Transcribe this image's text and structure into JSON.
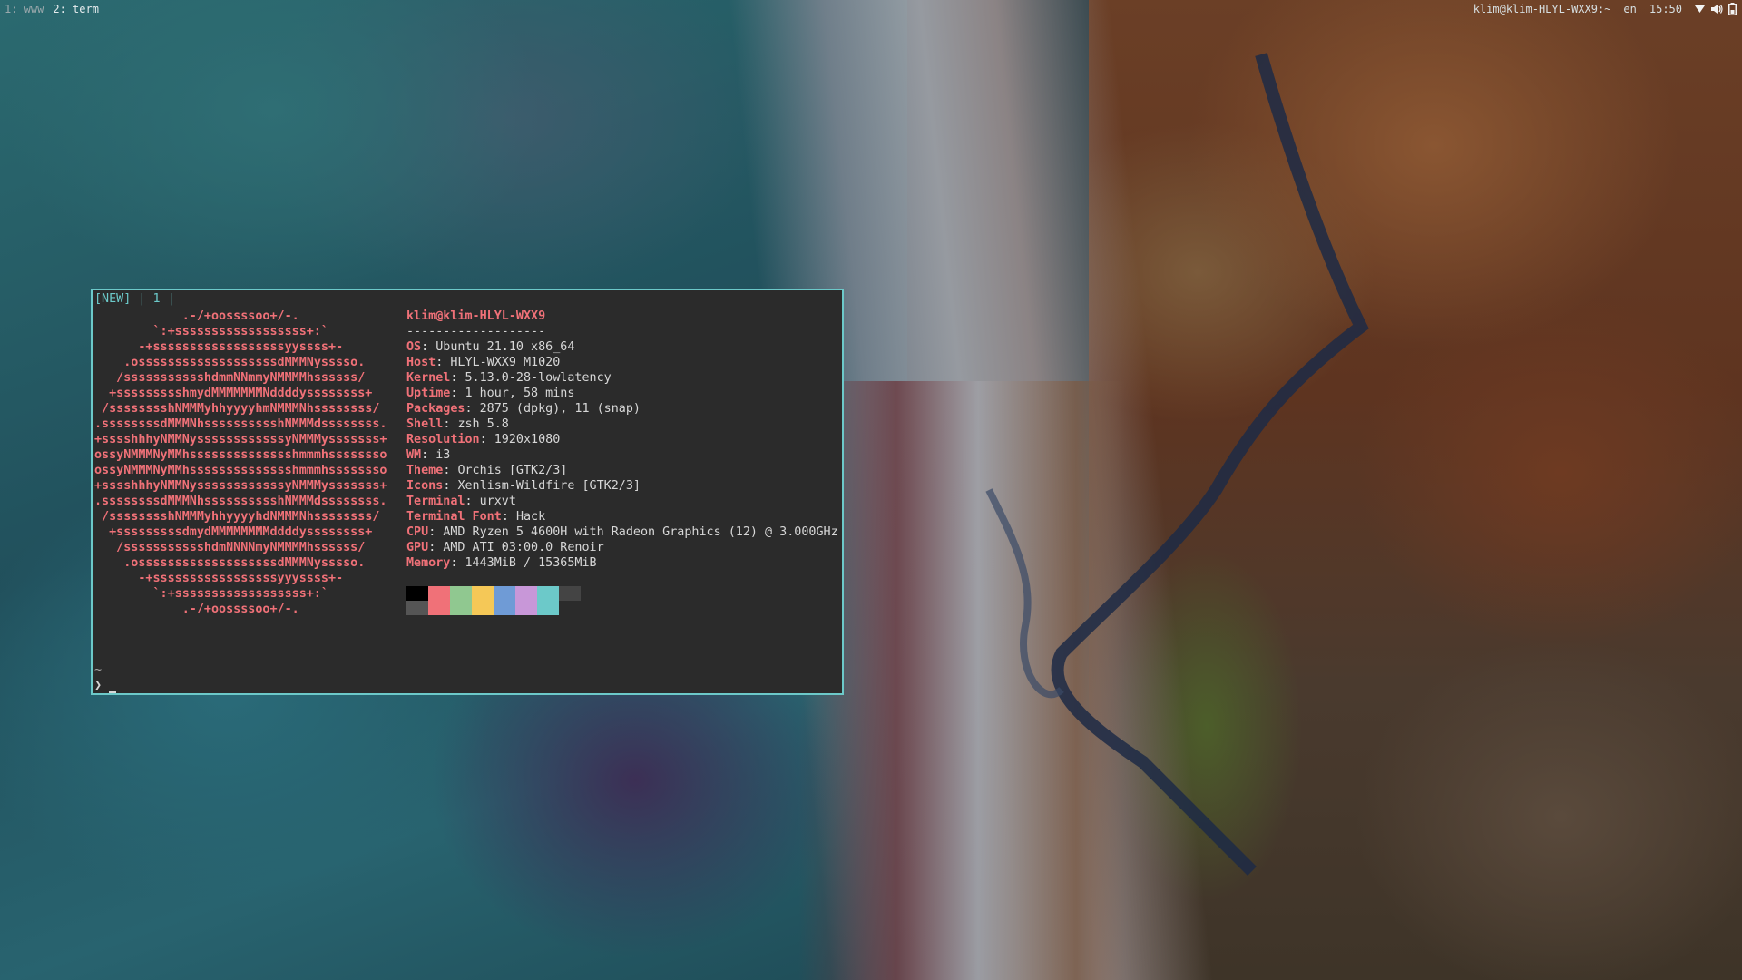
{
  "topbar": {
    "workspaces": [
      "1: www",
      "2: term"
    ],
    "active_workspace": "2: term",
    "window_title": "klim@klim-HLYL-WXX9:~",
    "keyboard_layout": "en",
    "clock": "15:50",
    "icons": [
      "wifi-icon",
      "volume-icon",
      "battery-icon"
    ]
  },
  "terminal": {
    "tabbar": "[NEW] | 1 |",
    "ascii_art": [
      "            .-/+oossssoo+/-.",
      "        `:+ssssssssssssssssss+:`",
      "      -+ssssssssssssssssssyyssss+-",
      "    .osssssssssssssssssssdMMMNysssso.",
      "   /ssssssssssshdmmNNmmyNMMMMhssssss/",
      "  +ssssssssshmydMMMMMMMNddddyssssssss+",
      " /sssssssshNMMMyhhyyyyhmNMMMNhssssssss/",
      ".ssssssssdMMMNhsssssssssshNMMMdssssssss.",
      "+sssshhhyNMMNyssssssssssssyNMMMysssssss+",
      "ossyNMMMNyMMhsssssssssssssshmmmhssssssso",
      "ossyNMMMNyMMhsssssssssssssshmmmhssssssso",
      "+sssshhhyNMMNyssssssssssssyNMMMysssssss+",
      ".ssssssssdMMMNhsssssssssshNMMMdssssssss.",
      " /sssssssshNMMMyhhyyyyhdNMMMNhssssssss/",
      "  +sssssssssdmydMMMMMMMMddddyssssssss+",
      "   /ssssssssssshdmNNNNmyNMMMMhssssss/",
      "    .osssssssssssssssssssdMMMNysssso.",
      "      -+sssssssssssssssssyyyssss+-",
      "        `:+ssssssssssssssssss+:`",
      "            .-/+oossssoo+/-."
    ],
    "userhost": "klim@klim-HLYL-WXX9",
    "separator": "-------------------",
    "info": [
      {
        "key": "OS",
        "value": "Ubuntu 21.10 x86_64"
      },
      {
        "key": "Host",
        "value": "HLYL-WXX9 M1020"
      },
      {
        "key": "Kernel",
        "value": "5.13.0-28-lowlatency"
      },
      {
        "key": "Uptime",
        "value": "1 hour, 58 mins"
      },
      {
        "key": "Packages",
        "value": "2875 (dpkg), 11 (snap)"
      },
      {
        "key": "Shell",
        "value": "zsh 5.8"
      },
      {
        "key": "Resolution",
        "value": "1920x1080"
      },
      {
        "key": "WM",
        "value": "i3"
      },
      {
        "key": "Theme",
        "value": "Orchis [GTK2/3]"
      },
      {
        "key": "Icons",
        "value": "Xenlism-Wildfire [GTK2/3]"
      },
      {
        "key": "Terminal",
        "value": "urxvt"
      },
      {
        "key": "Terminal Font",
        "value": "Hack"
      },
      {
        "key": "CPU",
        "value": "AMD Ryzen 5 4600H with Radeon Graphics (12) @ 3.000GHz"
      },
      {
        "key": "GPU",
        "value": "AMD ATI 03:00.0 Renoir"
      },
      {
        "key": "Memory",
        "value": "1443MiB / 15365MiB"
      }
    ],
    "palette": [
      "#000000",
      "#f07178",
      "#90c890",
      "#f5c857",
      "#6f9bd6",
      "#c897d8",
      "#6cc9c9",
      "#444444",
      "#555555",
      "#f07178",
      "#90c890",
      "#f5c857",
      "#6f9bd6",
      "#c897d8",
      "#6cc9c9",
      "#2b2b2b"
    ],
    "prompt_dir": "~",
    "prompt_symbol": "❯"
  }
}
